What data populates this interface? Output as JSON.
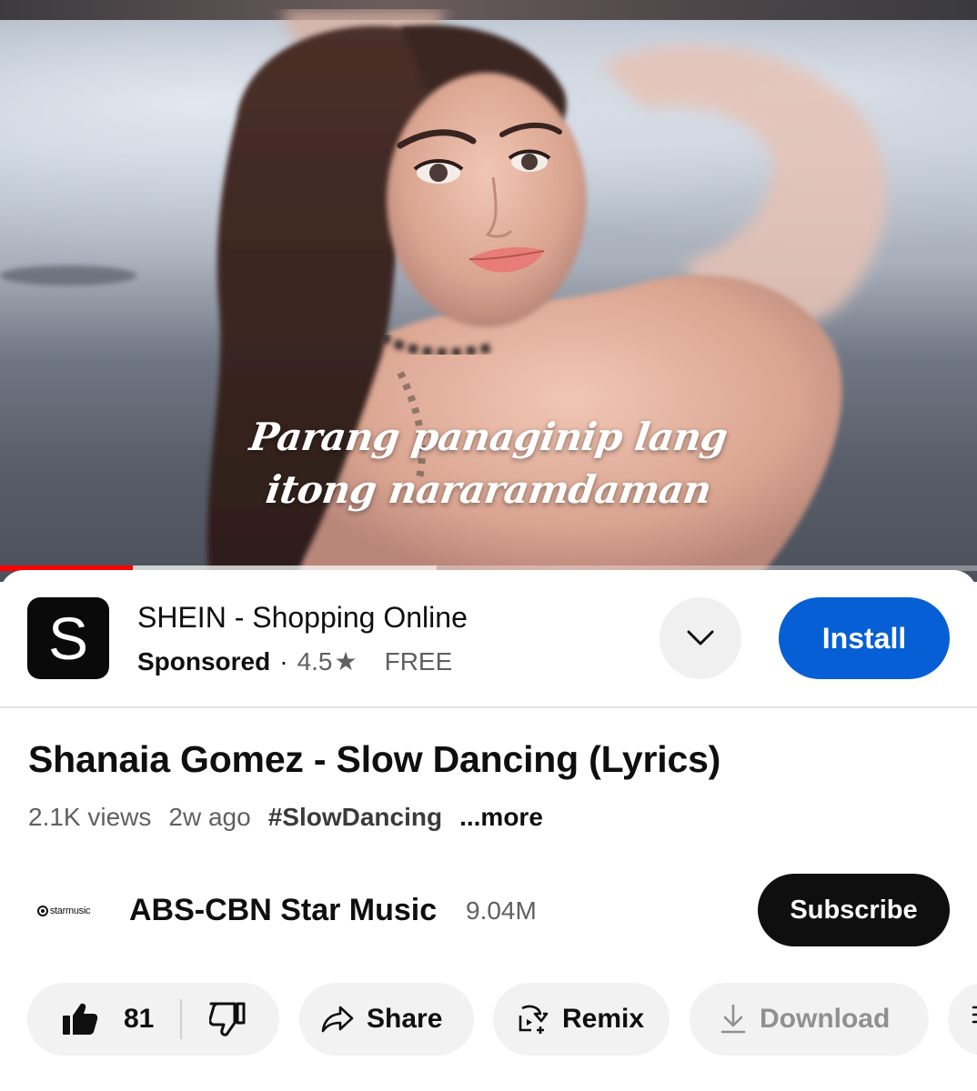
{
  "video": {
    "lyrics_line1": "Parang panaginip lang",
    "lyrics_line2": "itong nararamdaman",
    "progress_played": 0.136,
    "progress_buffered": 0.447
  },
  "ad": {
    "logo_letter": "S",
    "title": "SHEIN - Shopping Online",
    "sponsored": "Sponsored",
    "separator": "·",
    "rating": "4.5",
    "star": "★",
    "price": "FREE",
    "install_label": "Install",
    "expand_icon": "chevron-down-icon"
  },
  "details": {
    "title": "Shanaia Gomez - Slow Dancing (Lyrics)",
    "views": "2.1K views",
    "age": "2w ago",
    "hashtag": "#SlowDancing",
    "more": "...more"
  },
  "channel": {
    "logo_text": "starmusic",
    "name": "ABS-CBN Star Music",
    "subscribers": "9.04M",
    "subscribe_label": "Subscribe"
  },
  "actions": {
    "likes": "81",
    "share_label": "Share",
    "remix_label": "Remix",
    "download_label": "Download",
    "icons": [
      "thumbs-up-icon",
      "thumbs-down-icon",
      "share-icon",
      "remix-icon",
      "download-icon",
      "save-icon"
    ]
  },
  "colors": {
    "install_blue": "#065fd4",
    "progress_red": "#ff0000",
    "subscribe_black": "#0f0f0f",
    "pill_gray": "#f2f2f2",
    "secondary_text": "#606060"
  }
}
